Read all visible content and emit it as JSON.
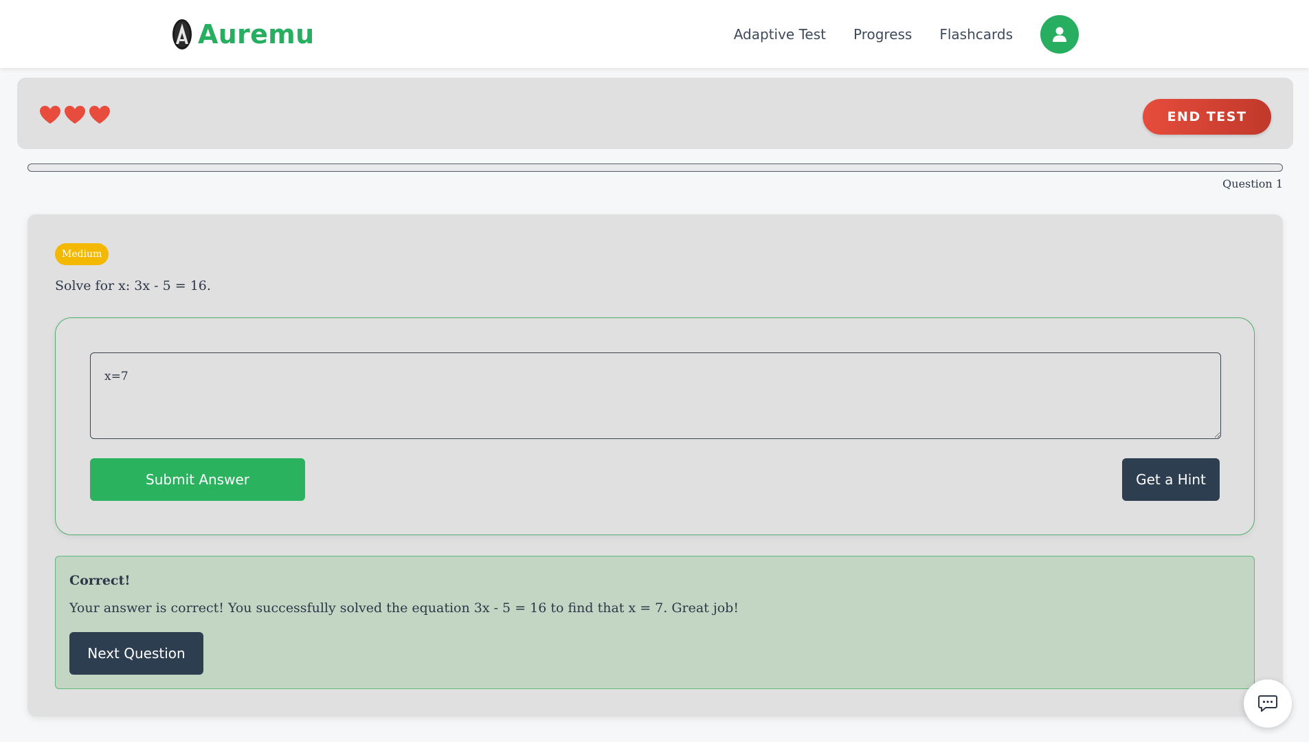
{
  "app": {
    "brand_name": "Auremu",
    "brand_color": "#27ae60"
  },
  "nav": {
    "links": [
      "Adaptive Test",
      "Progress",
      "Flashcards"
    ],
    "avatar_icon": "user-icon"
  },
  "status_bar": {
    "lives_remaining": 3,
    "heart_color": "#e74c3c",
    "end_test_label": "END TEST"
  },
  "progress": {
    "fraction": 0,
    "question_label": "Question 1"
  },
  "question": {
    "difficulty": "Medium",
    "difficulty_color": "#f5b800",
    "text": "Solve for x: 3x - 5 = 16.",
    "answer_value": "x=7",
    "submit_label": "Submit Answer",
    "hint_label": "Get a Hint"
  },
  "feedback": {
    "title": "Correct!",
    "message": "Your answer is correct! You successfully solved the equation 3x - 5 = 16 to find that x = 7. Great job!",
    "next_label": "Next Question"
  },
  "chat": {
    "icon": "chat-icon"
  }
}
